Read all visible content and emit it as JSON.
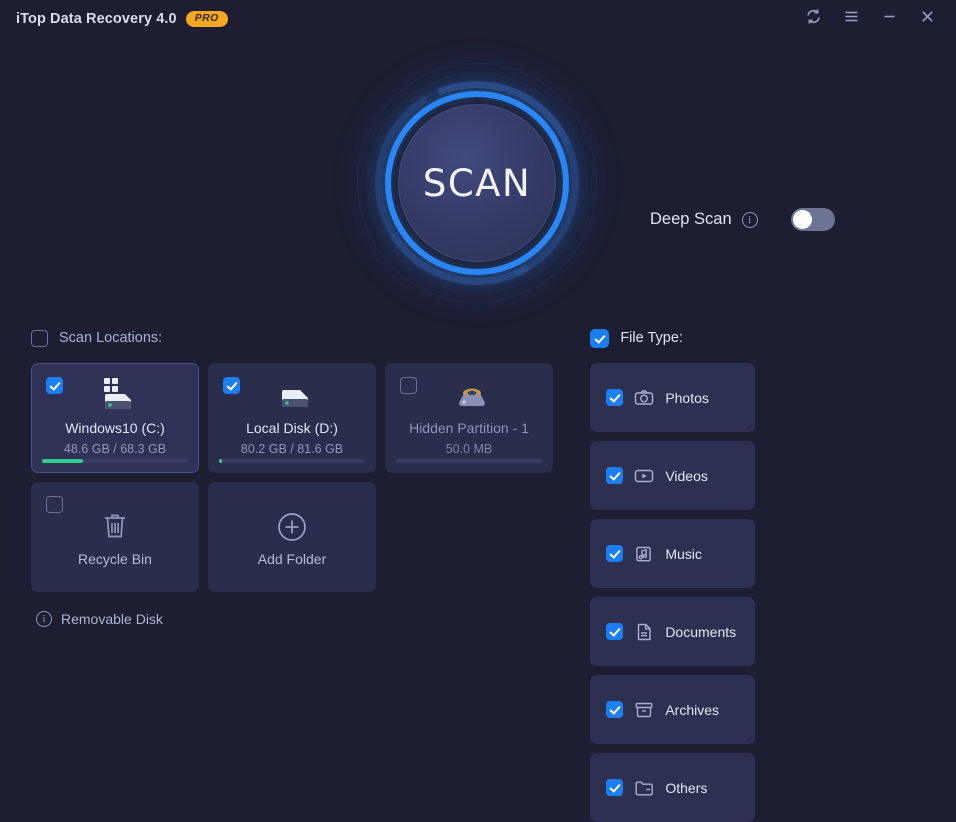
{
  "titlebar": {
    "app_title": "iTop Data Recovery 4.0",
    "pro_badge": "PRO",
    "controls": [
      {
        "name": "refresh-button",
        "icon": "refresh-icon"
      },
      {
        "name": "menu-button",
        "icon": "hamburger-menu-icon"
      },
      {
        "name": "minimize-button",
        "icon": "minimize-icon"
      },
      {
        "name": "close-button",
        "icon": "close-icon"
      }
    ]
  },
  "hero": {
    "scan_button_label": "SCAN",
    "deep_scan": {
      "label": "Deep Scan",
      "info_icon": "info-icon",
      "info_glyph": "i",
      "toggle_state": "off"
    }
  },
  "scan_locations": {
    "header_label": "Scan Locations:",
    "header_checked": false,
    "cards": [
      {
        "name": "Windows10 (C:)",
        "sub": "48.6 GB / 68.3 GB",
        "checked": true,
        "selected": true,
        "icon": "windows-drive-icon",
        "usage_percent": 28
      },
      {
        "name": "Local Disk (D:)",
        "sub": "80.2 GB / 81.6 GB",
        "checked": true,
        "selected": false,
        "icon": "hard-drive-icon",
        "usage_percent": 2
      },
      {
        "name": "Hidden Partition - 1",
        "sub": "50.0 MB",
        "checked": false,
        "selected": false,
        "icon": "hidden-partition-icon",
        "usage_percent": 0
      }
    ],
    "recycle_bin": {
      "label": "Recycle Bin",
      "checked": false,
      "icon": "trash-icon"
    },
    "add_folder": {
      "label": "Add Folder",
      "icon": "plus-circle-icon"
    }
  },
  "file_type": {
    "header_label": "File Type:",
    "header_checked": true,
    "items": [
      {
        "label": "Photos",
        "checked": true,
        "icon": "camera-icon"
      },
      {
        "label": "Videos",
        "checked": true,
        "icon": "video-play-icon"
      },
      {
        "label": "Music",
        "checked": true,
        "icon": "music-note-icon"
      },
      {
        "label": "Documents",
        "checked": true,
        "icon": "document-icon"
      },
      {
        "label": "Archives",
        "checked": true,
        "icon": "archive-box-icon"
      },
      {
        "label": "Others",
        "checked": true,
        "icon": "folder-icon"
      }
    ]
  },
  "footer": {
    "removable_disk_label": "Removable Disk",
    "removable_info_glyph": "i"
  },
  "colors": {
    "background": "#1d1e31",
    "card": "#2e3052",
    "accent_blue": "#1b7ef2",
    "ring_blue": "#2a86f5",
    "pro_badge": "#f5a623",
    "progress_green": "#2ecc8f"
  }
}
